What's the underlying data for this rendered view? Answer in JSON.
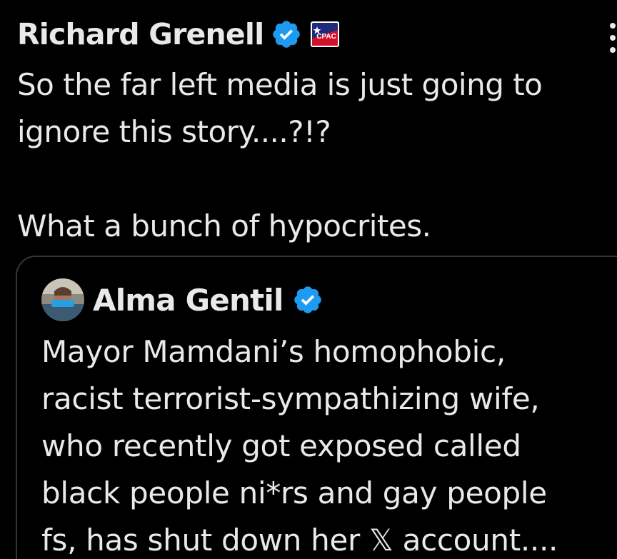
{
  "tweet": {
    "author_name": "Richard Grenell",
    "verified_icon": "verified-check-icon",
    "affiliate_badge": "cpac-badge-icon",
    "affiliate_badge_text": "CPAC",
    "text": "So the far left media is just going to\nignore this story....?!?\n\nWhat a bunch of hypocrites.",
    "more_icon": "more-options-icon"
  },
  "quoted_tweet": {
    "author_name": "Alma Gentil",
    "verified_icon": "verified-check-icon",
    "avatar_icon": "avatar",
    "text": "Mayor Mamdani’s homophobic,\nracist terrorist-sympathizing wife,\nwho recently got exposed called\nblack people ni*rs and gay people\nfs, has shut down her 𝕏 account...."
  },
  "colors": {
    "background": "#000000",
    "text": "#e7e9ea",
    "verified_blue": "#1d9bf0",
    "card_border": "#333639"
  }
}
